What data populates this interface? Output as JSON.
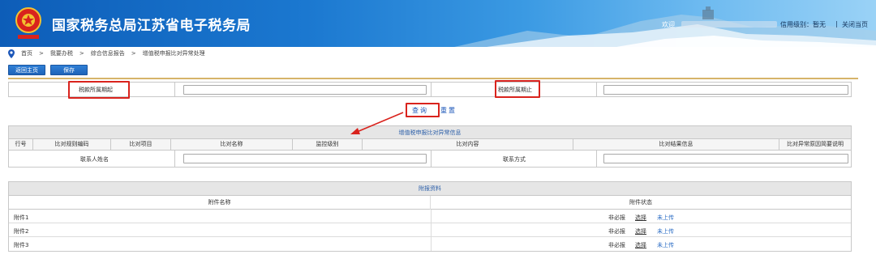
{
  "header": {
    "site_title": "国家税务总局江苏省电子税务局",
    "welcome": "欢迎",
    "credit_label": "信用级别：暂无",
    "separator": "|",
    "close_page": "关闭当页"
  },
  "breadcrumb": {
    "items": [
      "首页",
      "我要办税",
      "综合信息报告",
      "增值税申报比对异常处理"
    ],
    "arrow": ">"
  },
  "toolbar": {
    "home_label": "返回主页",
    "save_label": "保存"
  },
  "query": {
    "start_label": "税款所属期起",
    "end_label": "税款所属期止",
    "start_value": "",
    "end_value": "",
    "query_label": "查询",
    "reset_label": "重置"
  },
  "compare_table": {
    "title": "增值税申报比对异常信息",
    "columns": [
      "行号",
      "比对规则编码",
      "比对项目",
      "比对名称",
      "监控级别",
      "比对内容",
      "比对结果信息",
      "比对异常原因简要说明"
    ],
    "contact_name_label": "联系人姓名",
    "contact_method_label": "联系方式",
    "contact_name_value": "",
    "contact_method_value": ""
  },
  "attachments": {
    "title": "附报资料",
    "columns": [
      "附件名称",
      "附件状态"
    ],
    "rows": [
      {
        "name": "附件1",
        "required": "非必报",
        "select": "选择",
        "status": "未上传"
      },
      {
        "name": "附件2",
        "required": "非必报",
        "select": "选择",
        "status": "未上传"
      },
      {
        "name": "附件3",
        "required": "非必报",
        "select": "选择",
        "status": "未上传"
      }
    ]
  },
  "colors": {
    "brand_blue": "#1b78d0",
    "link_blue": "#1b56b8",
    "highlight_red": "#d9231d",
    "divider_gold": "#d6b46a"
  }
}
